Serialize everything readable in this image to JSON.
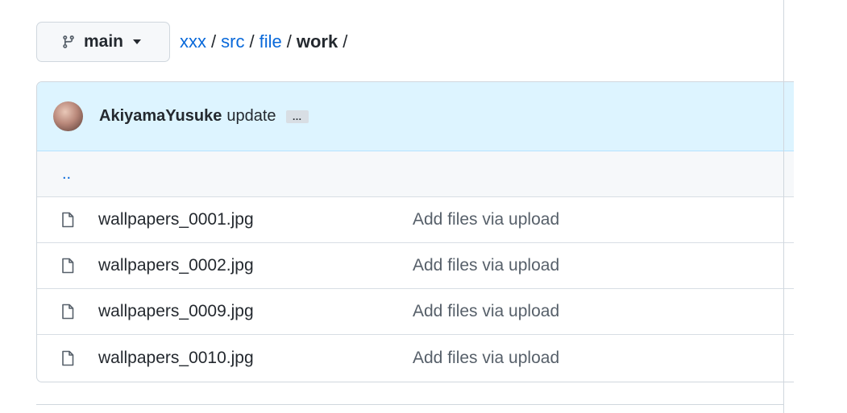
{
  "branch": {
    "icon": "git-branch-icon",
    "name": "main",
    "caret_icon": "caret-down-icon"
  },
  "breadcrumb": {
    "segments": [
      "xxx",
      "src",
      "file"
    ],
    "separator": "/",
    "current": "work",
    "trailing": "/"
  },
  "commit": {
    "author": "AkiyamaYusuke",
    "message": "update",
    "ellipsis": "…"
  },
  "parent_link": "..",
  "files": [
    {
      "name": "wallpapers_0001.jpg",
      "commit": "Add files via upload",
      "icon": "file-icon"
    },
    {
      "name": "wallpapers_0002.jpg",
      "commit": "Add files via upload",
      "icon": "file-icon"
    },
    {
      "name": "wallpapers_0009.jpg",
      "commit": "Add files via upload",
      "icon": "file-icon"
    },
    {
      "name": "wallpapers_0010.jpg",
      "commit": "Add files via upload",
      "icon": "file-icon"
    }
  ],
  "colors": {
    "link": "#0969da",
    "header_bg": "#ddf4ff",
    "border": "#d0d7de",
    "muted": "#57606a"
  }
}
